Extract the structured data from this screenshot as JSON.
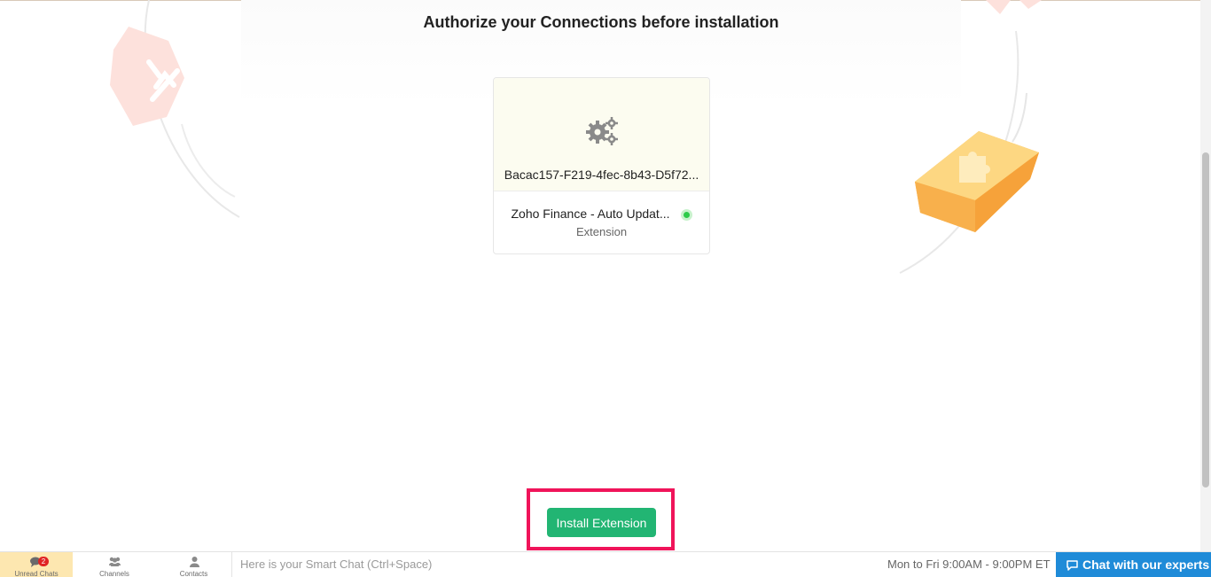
{
  "page": {
    "title": "Authorize your Connections before installation"
  },
  "connection_card": {
    "connection_name": "Bacac157-F219-4fec-8b43-D5f72...",
    "extension_name": "Zoho Finance - Auto Updat...",
    "extension_type": "Extension",
    "status_color": "#2ecb4a",
    "icon": "gears-icon"
  },
  "actions": {
    "install_label": "Install Extension",
    "install_color": "#22b573",
    "highlight_color": "#f0145a"
  },
  "bottom_bar": {
    "tabs": [
      {
        "label": "Unread Chats",
        "icon": "chat-bubbles-icon",
        "badge": "2"
      },
      {
        "label": "Channels",
        "icon": "group-icon"
      },
      {
        "label": "Contacts",
        "icon": "person-icon"
      }
    ],
    "smart_chat_placeholder": "Here is your Smart Chat (Ctrl+Space)",
    "hours": "Mon to Fri 9:00AM - 9:00PM ET",
    "chat_button_label": "Chat with our experts",
    "chat_button_color": "#1f8bd8"
  }
}
